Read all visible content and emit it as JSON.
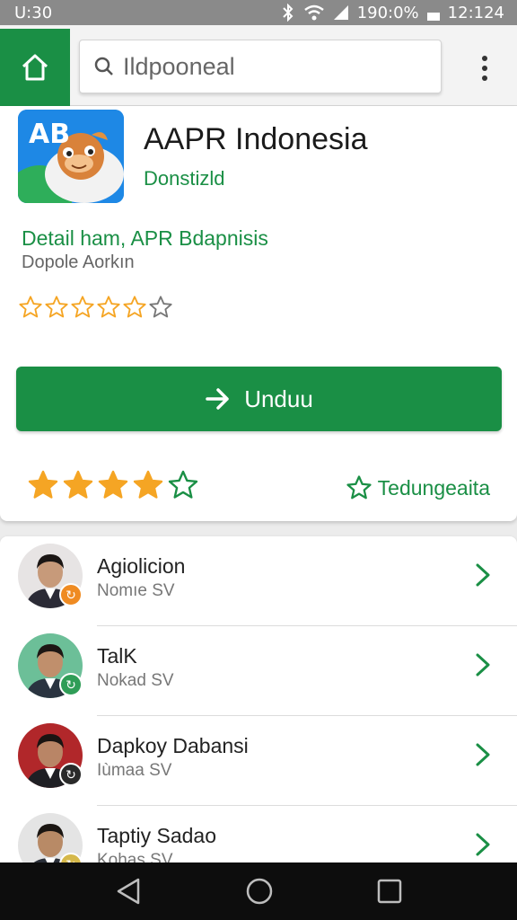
{
  "status_bar": {
    "time_left": "U:30",
    "battery": "190:0%",
    "time_right": "12:124"
  },
  "search": {
    "placeholder": "Ildpooneal"
  },
  "app": {
    "icon_text": "AB",
    "title": "AAPR Indonesia",
    "developer": "Donstizld",
    "detail_title": "Detail ham, APR Bdapnisis",
    "detail_subtitle": "Dopole Aorkın",
    "outline_star_count": 6,
    "install_label": "Unduu",
    "rating_filled": 4,
    "rating_total": 5,
    "wishlist_label": "Tedungeaita"
  },
  "people": [
    {
      "name": "Agiolicion",
      "role": "Nomıe SV",
      "badge_color": "#ef8b22",
      "bg": "#e7e4e4",
      "skin": "#c79a7a",
      "hair": "#1b1614",
      "shirt": "#2b2b36"
    },
    {
      "name": "TalK",
      "role": "Nokad SV",
      "badge_color": "#2f9d57",
      "bg": "#6cbf98",
      "skin": "#c08f6c",
      "hair": "#1d1714",
      "shirt": "#2a3440"
    },
    {
      "name": "Dapkoy Dabansi",
      "role": "Iùmaa SV",
      "badge_color": "#2a2a2a",
      "bg": "#b1272a",
      "skin": "#b98566",
      "hair": "#1a1412",
      "shirt": "#1f1f24"
    },
    {
      "name": "Taptiy Sadao",
      "role": "Kohas SV",
      "badge_color": "#d5b84a",
      "bg": "#e4e4e4",
      "skin": "#b88a66",
      "hair": "#1b1612",
      "shirt": "#2a2f38"
    }
  ],
  "colors": {
    "brand_green": "#1a8f45",
    "star_gold": "#f5a524"
  }
}
